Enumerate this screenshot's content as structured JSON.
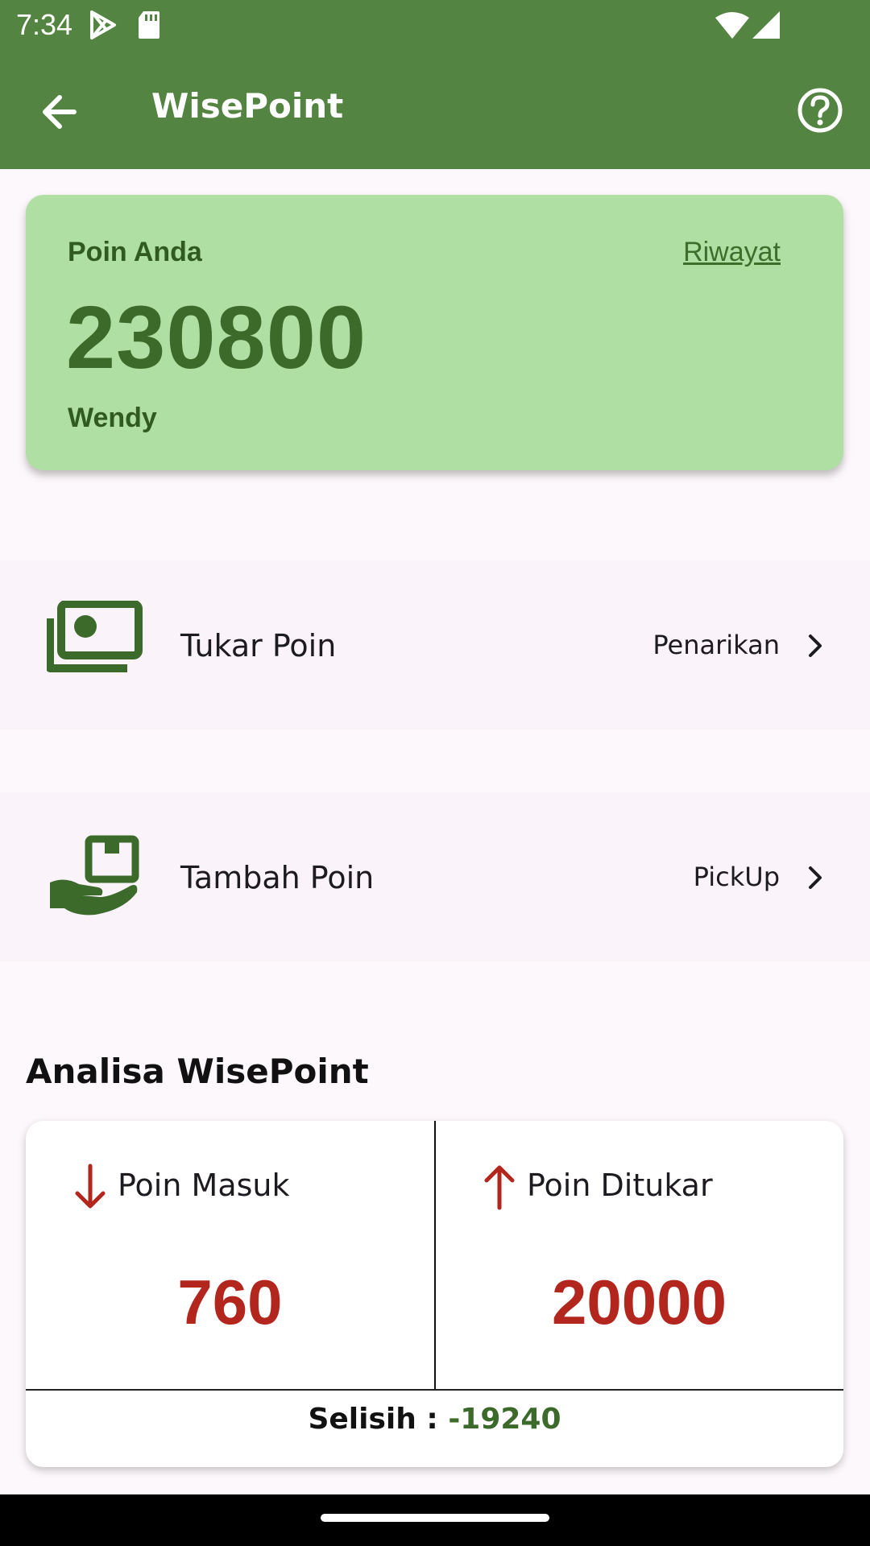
{
  "status_bar": {
    "time": "7:34"
  },
  "app_bar": {
    "title": "WisePoint"
  },
  "points_card": {
    "label": "Poin Anda",
    "history_link": "Riwayat",
    "points": "230800",
    "user_name": "Wendy",
    "background_color": "#b0dfa4"
  },
  "menu": [
    {
      "label": "Tukar Poin",
      "action": "Penarikan",
      "icon": "money-icon"
    },
    {
      "label": "Tambah Poin",
      "action": "PickUp",
      "icon": "hand-box-icon"
    }
  ],
  "analysis": {
    "title": "Analisa WisePoint",
    "incoming": {
      "label": "Poin Masuk",
      "value": "760",
      "icon": "arrow-down-icon"
    },
    "redeemed": {
      "label": "Poin Ditukar",
      "value": "20000",
      "icon": "arrow-up-icon"
    },
    "difference_label": "Selisih : ",
    "difference_value": "-19240"
  },
  "colors": {
    "primary": "#538441",
    "accent_red": "#b3261e",
    "dark_green": "#3b6a2a"
  }
}
